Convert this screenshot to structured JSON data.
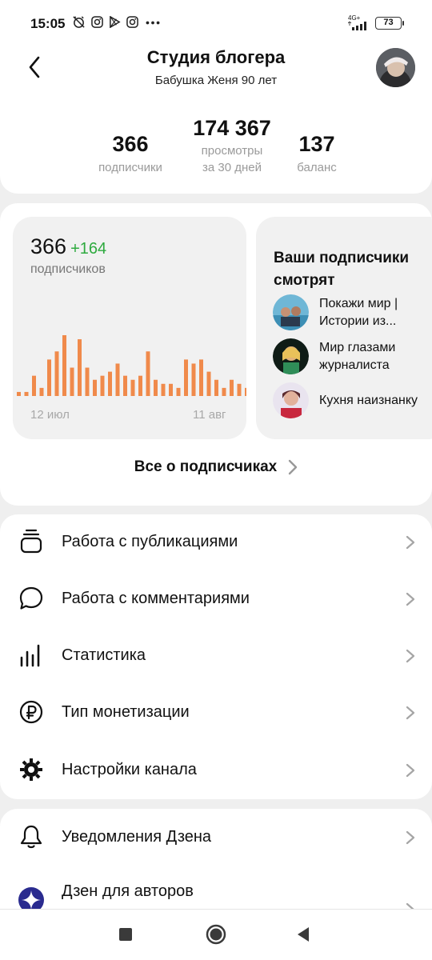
{
  "status_bar": {
    "time": "15:05",
    "network": "4G+",
    "battery": "73"
  },
  "header": {
    "title": "Студия блогера",
    "subtitle": "Бабушка Женя 90 лет"
  },
  "stats": [
    {
      "value": "366",
      "label_line1": "подписчики",
      "label_line2": ""
    },
    {
      "value": "174 367",
      "label_line1": "просмотры",
      "label_line2": "за 30 дней"
    },
    {
      "value": "137",
      "label_line1": "баланс",
      "label_line2": ""
    }
  ],
  "subscribers": {
    "count": "366",
    "delta": "+164",
    "label": "подписчиков",
    "x_start": "12 июл",
    "x_end": "11 авг",
    "all_link": "Все о подписчиках"
  },
  "chart_data": {
    "type": "bar",
    "color": "#f08a4b",
    "values": [
      1,
      1,
      5,
      2,
      9,
      11,
      15,
      7,
      14,
      7,
      4,
      5,
      6,
      8,
      5,
      4,
      5,
      11,
      4,
      3,
      3,
      2,
      9,
      8,
      9,
      6,
      4,
      2,
      4,
      3,
      2
    ]
  },
  "viewers": {
    "title": "Ваши подписчики смотрят",
    "items": [
      {
        "name": "Покажи мир | Истории из..."
      },
      {
        "name": "Мир глазами журналиста"
      },
      {
        "name": "Кухня наизнанку"
      }
    ]
  },
  "menu": [
    {
      "label": "Работа с публикациями",
      "icon": "publications-icon"
    },
    {
      "label": "Работа с комментариями",
      "icon": "comment-icon"
    },
    {
      "label": "Статистика",
      "icon": "statistics-icon"
    },
    {
      "label": "Тип монетизации",
      "icon": "ruble-icon"
    },
    {
      "label": "Настройки канала",
      "icon": "gear-icon"
    }
  ],
  "menu2": [
    {
      "label": "Уведомления Дзена",
      "icon": "bell-icon"
    },
    {
      "label": "Дзен для авторов",
      "icon": "zen-logo-icon"
    }
  ],
  "colors": {
    "accent_orange": "#f08a4b",
    "delta_green": "#2eaa3f"
  }
}
